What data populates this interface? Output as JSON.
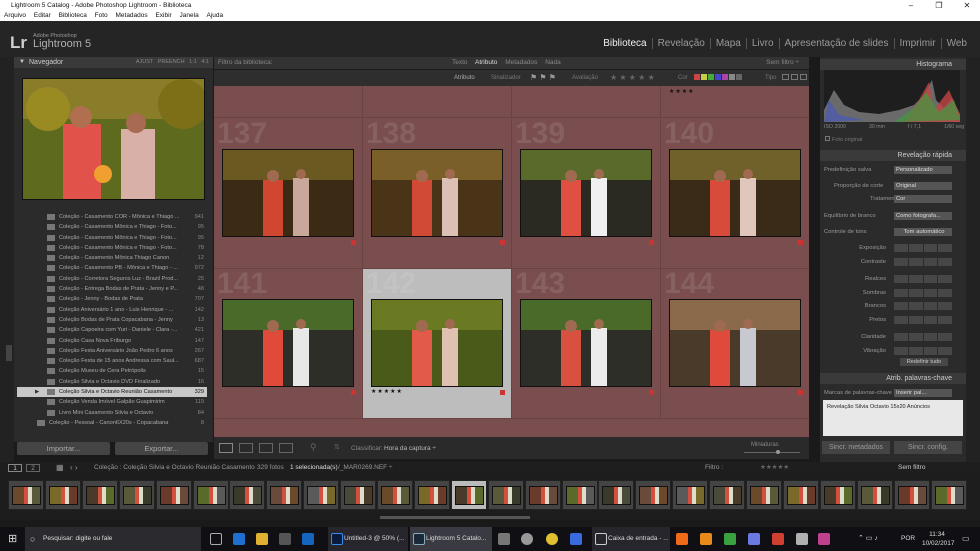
{
  "window": {
    "title": "Lightroom 5 Catalog - Adobe Photoshop Lightroom - Biblioteca",
    "min": "–",
    "max": "❐",
    "close": "✕"
  },
  "menu": [
    "Arquivo",
    "Editar",
    "Biblioteca",
    "Foto",
    "Metadados",
    "Exibir",
    "Janela",
    "Ajuda"
  ],
  "identity": {
    "logo": "Lr",
    "vendor": "Adobe Photoshop",
    "product": "Lightroom 5"
  },
  "modules": [
    "Biblioteca",
    "Revelação",
    "Mapa",
    "Livro",
    "Apresentação de slides",
    "Imprimir",
    "Web"
  ],
  "navigator": {
    "title": "Navegador",
    "options": [
      "AJUST",
      "PREENCH",
      "1:1",
      "4:1"
    ]
  },
  "collections": [
    {
      "name": "Coleção - Casamento COR - Mônica e Thiago ...",
      "count": "941"
    },
    {
      "name": "Coleção - Casamento Mônica e Thiago - Foto...",
      "count": "95"
    },
    {
      "name": "Coleção - Casamento Mônica e Thiago - Foto...",
      "count": "95"
    },
    {
      "name": "Coleção - Casamento Mônica e Thiago - Foto...",
      "count": "78"
    },
    {
      "name": "Coleção - Casamento Mônica Thiago Canon",
      "count": "12"
    },
    {
      "name": "Coleção - Casamento PB - Mônica e Thiago - ...",
      "count": "972"
    },
    {
      "name": "Coleção - Corretora Seguros Luz - Brazil Prod...",
      "count": "25"
    },
    {
      "name": "Coleção - Entrega Bodas de Prata - Jenny e P...",
      "count": "48"
    },
    {
      "name": "Coleção - Jenny - Bodas de Prata",
      "count": "707"
    },
    {
      "name": "Coleção Aniversário 1 ano - Luis Henrique - ...",
      "count": "142"
    },
    {
      "name": "Coleção Bodas de Prata Copacabana - Jenny",
      "count": "13"
    },
    {
      "name": "Coleção Capoeira com Yuri - Daniele - Clara -...",
      "count": "421"
    },
    {
      "name": "Coleção Casa Nova Friburgo",
      "count": "147"
    },
    {
      "name": "Coleção Festa Aniversário João Pedro 6 anos",
      "count": "267"
    },
    {
      "name": "Coleção Festa de 15 anos Andressa com Saul...",
      "count": "687"
    },
    {
      "name": "Coleção Museu de Cera Petrópolis",
      "count": "15"
    },
    {
      "name": "Coleção Silvia e Octavio DVD Finalizado",
      "count": "16"
    },
    {
      "name": "Coleção Silvia e Octavio Reunião Casamento",
      "count": "329",
      "selected": true
    },
    {
      "name": "Coleção Venda Imóvel Galpão Guapimirim",
      "count": "119"
    },
    {
      "name": "Livro Mini Casamento Silvia e Octavio",
      "count": "84"
    },
    {
      "name": "Coleção - Pessoal - Canon6X20s - Copacabana",
      "count": "8",
      "group": true
    }
  ],
  "left_buttons": {
    "import": "Importar...",
    "export": "Exportar..."
  },
  "filter": {
    "label": "Filtro da biblioteca:",
    "tabs": [
      "Texto",
      "Atributo",
      "Metadados",
      "Nada"
    ],
    "active": "Atributo",
    "preset": "Sem filtro ÷"
  },
  "attrbar": {
    "attr": "Atributo",
    "flag": "Sinalizador",
    "rating": "Avaliação",
    "stars": "★ ★ ★ ★ ★",
    "color": "Cor",
    "kind": "Tipo"
  },
  "grid": {
    "cells": [
      {
        "num": "137",
        "stars": ""
      },
      {
        "num": "138",
        "stars": ""
      },
      {
        "num": "139",
        "stars": ""
      },
      {
        "num": "140",
        "stars": ""
      },
      {
        "num": "141",
        "stars": ""
      },
      {
        "num": "142",
        "stars": "★★★★★",
        "selected": true
      },
      {
        "num": "143",
        "stars": ""
      },
      {
        "num": "144",
        "stars": ""
      }
    ],
    "top_stars": "★★★★"
  },
  "gridtool": {
    "sort_label": "Classificar:",
    "sort_value": "Hora da captura ÷",
    "thumbs_label": "Miniaturas"
  },
  "right": {
    "histogram": "Histograma",
    "hist_info": [
      "ISO 2000",
      "30 mm",
      "f / 7,1",
      "1/60 seg"
    ],
    "original": "Foto original",
    "quick_develop": "Revelação rápida",
    "saved_preset": {
      "label": "Predefinição salva",
      "value": "Personalizado"
    },
    "crop": {
      "label": "Proporção de corte",
      "value": "Original"
    },
    "treatment": {
      "label": "Tratamento",
      "value": "Cor"
    },
    "wb": {
      "label": "Equilíbrio de branco",
      "value": "Como fotografa..."
    },
    "tone": {
      "label": "Controle de tons",
      "value": "Tom automático"
    },
    "sliders": [
      "Exposição",
      "Contraste",
      "Realces",
      "Sombras",
      "Brancos",
      "Pretos",
      "Claridade",
      "Vibração"
    ],
    "reset": "Redefinir tudo",
    "keywording": "Atrib. palavras-chave",
    "kw_tags": {
      "label": "Marcas de palavras-chave",
      "value": "Inserir pal..."
    },
    "kw_text": "Revelação Silvia Octavio 15x20 Anúncios",
    "sync_meta": "Sincr. metadados",
    "sync_settings": "Sincr. config."
  },
  "status": {
    "pages": [
      "1",
      "2"
    ],
    "path": "Coleção : Coleção Silvia e Octavio Reunião Casamento",
    "count": "329 fotos",
    "selected": "1 selecionada(s)",
    "file": "/_MAR0269.NEF ÷",
    "filter": "Filtro :",
    "nofilter": "Sem filtro"
  },
  "taskbar": {
    "search": "Pesquisar: digite ou fale",
    "apps": [
      "Untitled-3 @ 50% (...",
      "Lightroom 5 Catalo...",
      "Caixa de entrada - ..."
    ],
    "lang": "POR",
    "time": "11:34",
    "date": "10/02/2017"
  },
  "colors": {
    "grid_bg": "#7a4e4f",
    "accent": "#f0f0f0",
    "panel": "#2b2b2b"
  }
}
